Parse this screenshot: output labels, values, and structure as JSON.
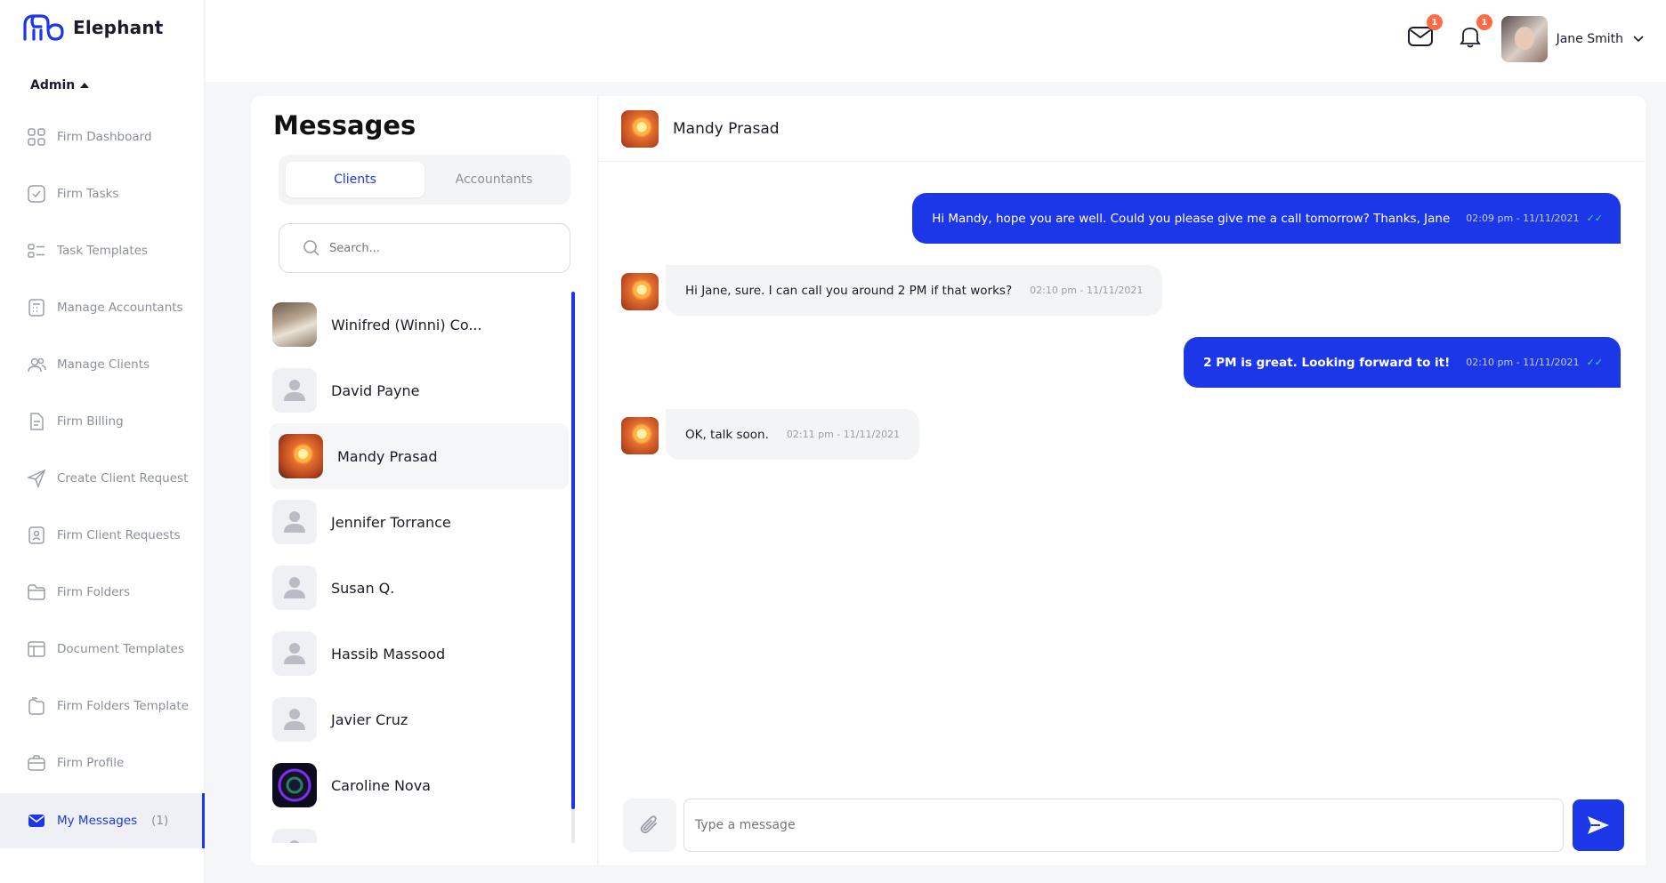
{
  "app": {
    "name": "Elephant"
  },
  "sidebar": {
    "role": "Admin",
    "items": [
      {
        "label": "Firm Dashboard",
        "icon": "grid-icon"
      },
      {
        "label": "Firm Tasks",
        "icon": "checkbox-icon"
      },
      {
        "label": "Task Templates",
        "icon": "template-icon"
      },
      {
        "label": "Manage Accountants",
        "icon": "calculator-icon"
      },
      {
        "label": "Manage Clients",
        "icon": "users-icon"
      },
      {
        "label": "Firm Billing",
        "icon": "invoice-icon"
      },
      {
        "label": "Create Client Request",
        "icon": "send-icon"
      },
      {
        "label": "Firm Client Requests",
        "icon": "request-icon"
      },
      {
        "label": "Firm Folders",
        "icon": "folder-icon"
      },
      {
        "label": "Document Templates",
        "icon": "layout-icon"
      },
      {
        "label": "Firm Folders Template",
        "icon": "folders-icon"
      },
      {
        "label": "Firm Profile",
        "icon": "briefcase-icon"
      },
      {
        "label": "My Messages",
        "count": "(1)",
        "icon": "mail-icon",
        "active": true
      }
    ]
  },
  "header": {
    "mail_badge": "1",
    "notification_badge": "1",
    "user_name": "Jane Smith"
  },
  "messages_panel": {
    "title": "Messages",
    "tabs": [
      "Clients",
      "Accountants"
    ],
    "active_tab": "Clients",
    "search_placeholder": "Search...",
    "contacts": [
      {
        "name": "Winifred (Winni) Co...",
        "avatar": "photo"
      },
      {
        "name": "David Payne",
        "avatar": "default"
      },
      {
        "name": "Mandy Prasad",
        "avatar": "photo",
        "active": true
      },
      {
        "name": "Jennifer Torrance",
        "avatar": "default"
      },
      {
        "name": "Susan Q.",
        "avatar": "default"
      },
      {
        "name": "Hassib Massood",
        "avatar": "default"
      },
      {
        "name": "Javier Cruz",
        "avatar": "default"
      },
      {
        "name": "Caroline Nova",
        "avatar": "photo"
      }
    ]
  },
  "chat": {
    "contact_name": "Mandy Prasad",
    "messages": [
      {
        "direction": "out",
        "text": "Hi Mandy, hope you are well. Could you please give me a call tomorrow? Thanks, Jane",
        "time": "02:09 pm - 11/11/2021"
      },
      {
        "direction": "in",
        "text": "Hi Jane, sure. I can call you around 2 PM if that works?",
        "time": "02:10 pm - 11/11/2021"
      },
      {
        "direction": "out",
        "text": "2 PM is great. Looking forward to it!",
        "time": "02:10 pm - 11/11/2021"
      },
      {
        "direction": "in",
        "text": "OK, talk soon.",
        "time": "02:11 pm - 11/11/2021"
      }
    ],
    "input_placeholder": "Type a message"
  },
  "colors": {
    "accent": "#1c37e8",
    "badge": "#ff6b45",
    "read_check": "#4fd3b4"
  }
}
